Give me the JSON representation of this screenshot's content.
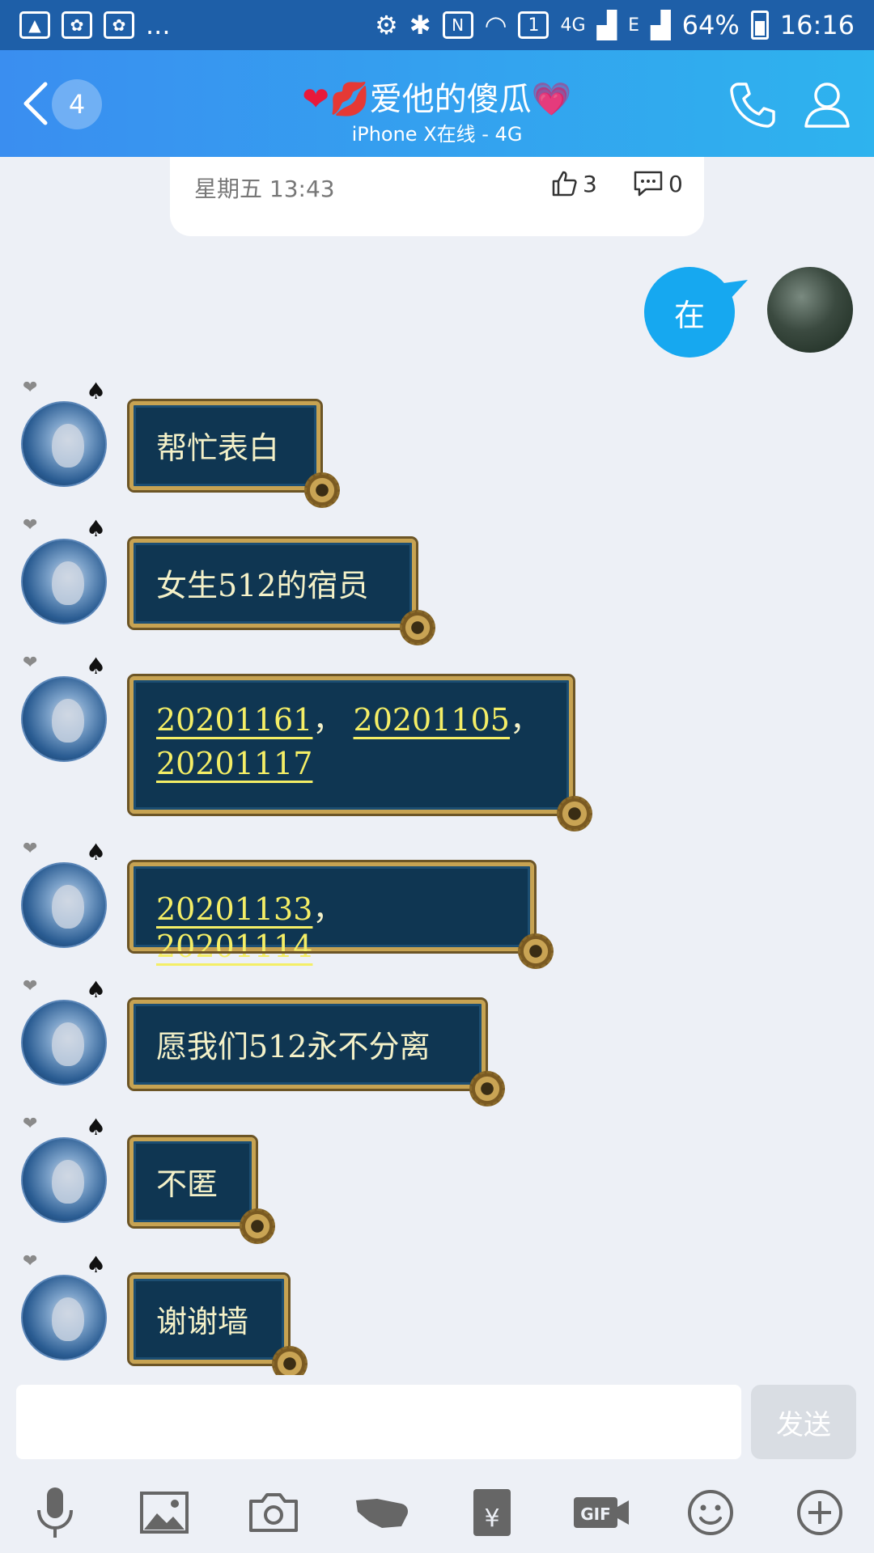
{
  "status_bar": {
    "network": "4G",
    "network2": "E",
    "sim": "1",
    "nfc": "N",
    "battery": "64%",
    "time": "16:16",
    "more": "..."
  },
  "header": {
    "back_count": "4",
    "title_heart_left": "❤",
    "title_lips": "💋",
    "title": "爱他的傻瓜",
    "title_heart_right": "💗",
    "subtitle": "iPhone X在线 - 4G",
    "colors": {
      "gradient_start": "#3a8ef0",
      "gradient_end": "#2eb3ee"
    }
  },
  "feed_card": {
    "date": "星期五 13:43",
    "likes": "3",
    "comments": "0"
  },
  "outgoing_message": {
    "text": "在",
    "color": "#16a8f0"
  },
  "incoming_messages": [
    {
      "text": "帮忙表白"
    },
    {
      "text": "女生512的宿员"
    },
    {
      "parts": [
        "20201161",
        "20201105",
        "20201117"
      ],
      "sep": "，"
    },
    {
      "parts": [
        "20201133",
        "20201114"
      ],
      "sep": "，"
    },
    {
      "text": "愿我们512永不分离"
    },
    {
      "text": "不匿"
    },
    {
      "text": "谢谢墙"
    }
  ],
  "composer": {
    "input_value": "",
    "send_label": "发送",
    "tools": [
      "microphone-icon",
      "image-icon",
      "camera-icon",
      "poke-icon",
      "red-packet-icon",
      "gif-icon",
      "emoji-icon",
      "plus-icon"
    ],
    "gif_label": "GIF",
    "yuan_label": "¥"
  }
}
